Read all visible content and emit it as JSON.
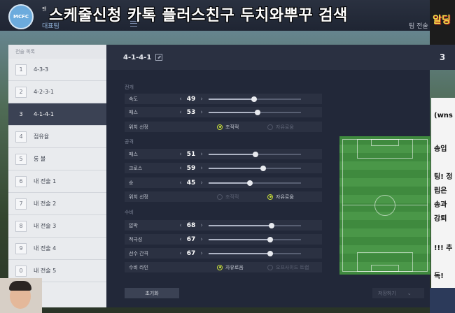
{
  "header": {
    "team_small": "팬",
    "team_name": "대표팀",
    "team_tactics": "팀 전술",
    "crest_text": "MCFC"
  },
  "overlay_title": "스케줄신청 카톡 플러스친구 두치와뿌꾸 검색",
  "sidebar": {
    "title": "전술 목록",
    "items": [
      {
        "num": "1",
        "label": "4-3-3"
      },
      {
        "num": "2",
        "label": "4-2-3-1"
      },
      {
        "num": "3",
        "label": "4-1-4-1"
      },
      {
        "num": "4",
        "label": "점유율"
      },
      {
        "num": "5",
        "label": "롱 볼"
      },
      {
        "num": "6",
        "label": "내 전술 1"
      },
      {
        "num": "7",
        "label": "내 전술 2"
      },
      {
        "num": "8",
        "label": "내 전술 3"
      },
      {
        "num": "9",
        "label": "내 전술 4"
      },
      {
        "num": "0",
        "label": "내 전술 5"
      }
    ],
    "active_index": 2
  },
  "main": {
    "formation": "4-1-4-1",
    "right_number": "3",
    "sections": {
      "buildup": "전개",
      "chance": "공격",
      "defence": "수비"
    },
    "buildup": {
      "speed": {
        "label": "속도",
        "value": "49",
        "level": 49
      },
      "pass": {
        "label": "패스",
        "value": "53",
        "level": 53
      },
      "position": {
        "label": "위치 선정",
        "opt1": "조직적",
        "opt2": "자유로움",
        "selected": "opt1"
      }
    },
    "chance": {
      "pass": {
        "label": "패스",
        "value": "51",
        "level": 51
      },
      "cross": {
        "label": "크로스",
        "value": "59",
        "level": 59
      },
      "shoot": {
        "label": "슛",
        "value": "45",
        "level": 45
      },
      "position": {
        "label": "위치 선정",
        "opt1": "조직적",
        "opt2": "자유로움",
        "selected": "opt2"
      }
    },
    "defence": {
      "pressure": {
        "label": "압박",
        "value": "68",
        "level": 68
      },
      "aggression": {
        "label": "적극성",
        "value": "67",
        "level": 67
      },
      "width": {
        "label": "선수 간격",
        "value": "67",
        "level": 67
      },
      "line": {
        "label": "수비 라인",
        "opt1": "자유로움",
        "opt2": "오프사이드 트랩",
        "selected": "opt1"
      }
    },
    "reset_label": "초기화",
    "save_label": "저장하기"
  },
  "chat": {
    "lines": [
      "(wns",
      "송입",
      "팅! 정",
      "립은",
      "송과",
      "강퇴",
      "!!! 추",
      "독!"
    ]
  },
  "ad_text": "알딩"
}
